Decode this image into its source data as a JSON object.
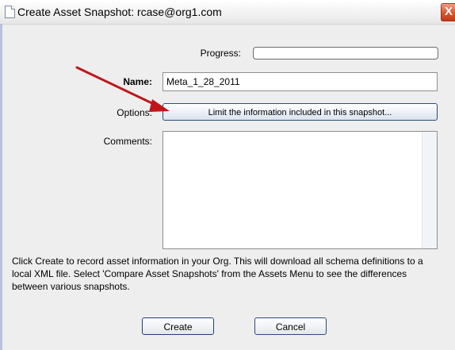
{
  "window": {
    "title": "Create Asset Snapshot: rcase@org1.com",
    "close_glyph": "X"
  },
  "form": {
    "progress_label": "Progress:",
    "progress_value": 0,
    "name_label": "Name:",
    "name_value": "Meta_1_28_2011",
    "options_label": "Options:",
    "options_button": "Limit the information included in this snapshot...",
    "comments_label": "Comments:",
    "comments_value": ""
  },
  "info": {
    "text": "Click Create to record asset information in your Org. This will download all schema definitions to a local XML file. Select 'Compare Asset Snapshots' from the Assets Menu to see the differences between various snapshots."
  },
  "buttons": {
    "create": "Create",
    "cancel": "Cancel"
  },
  "annotation": {
    "arrow_color": "#c0161b"
  }
}
